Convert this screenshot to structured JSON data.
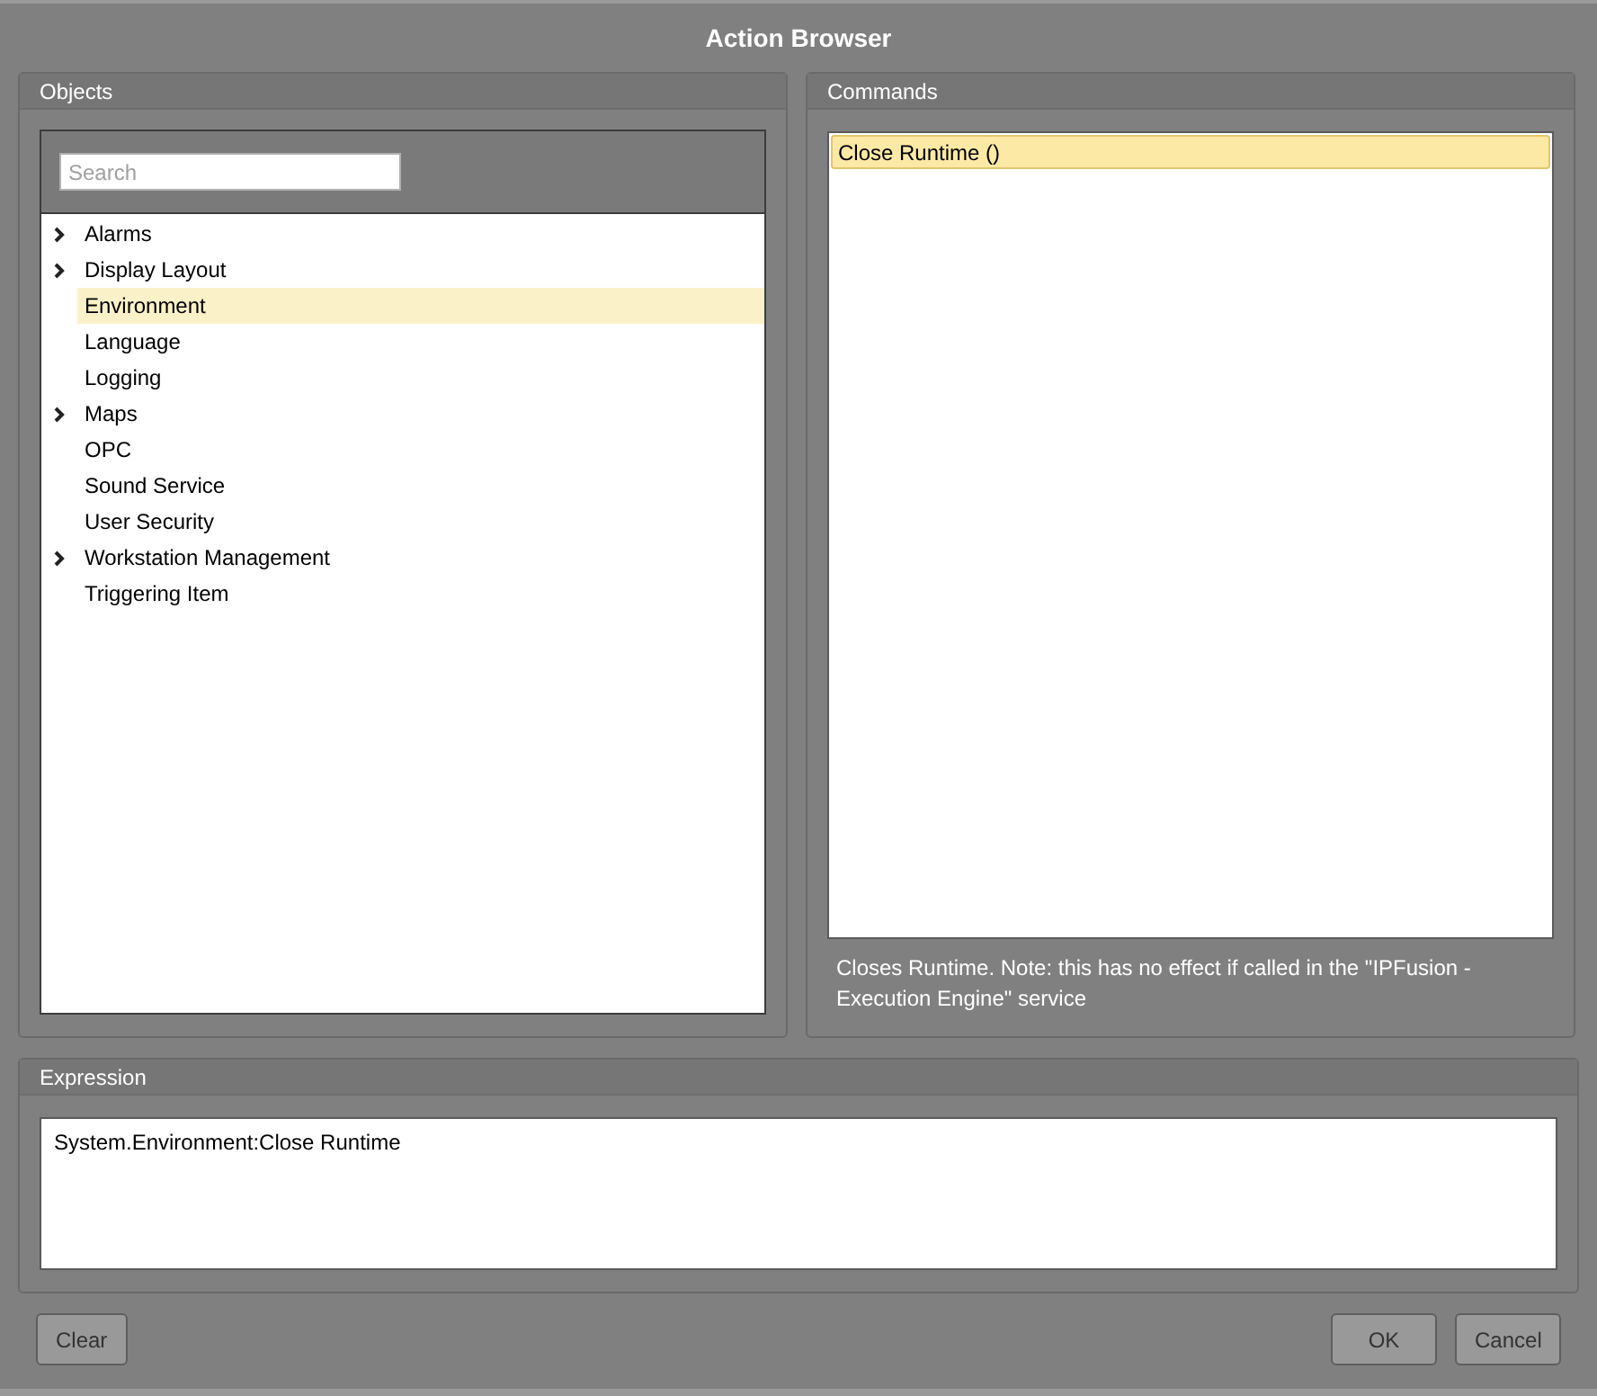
{
  "window": {
    "title": "Action Browser"
  },
  "objects": {
    "title": "Objects",
    "search": {
      "placeholder": "Search"
    },
    "items": [
      {
        "label": "Alarms",
        "expandable": true,
        "selected": false
      },
      {
        "label": "Display Layout",
        "expandable": true,
        "selected": false
      },
      {
        "label": "Environment",
        "expandable": false,
        "selected": true
      },
      {
        "label": "Language",
        "expandable": false,
        "selected": false
      },
      {
        "label": "Logging",
        "expandable": false,
        "selected": false
      },
      {
        "label": "Maps",
        "expandable": true,
        "selected": false
      },
      {
        "label": "OPC",
        "expandable": false,
        "selected": false
      },
      {
        "label": "Sound Service",
        "expandable": false,
        "selected": false
      },
      {
        "label": "User Security",
        "expandable": false,
        "selected": false
      },
      {
        "label": "Workstation Management",
        "expandable": true,
        "selected": false
      },
      {
        "label": "Triggering Item",
        "expandable": false,
        "selected": false
      }
    ]
  },
  "commands": {
    "title": "Commands",
    "items": [
      {
        "label": "Close Runtime ()",
        "selected": true
      }
    ],
    "description": "Closes Runtime. Note: this has no effect if called in the \"IPFusion - Execution Engine\" service"
  },
  "expression": {
    "title": "Expression",
    "value": "System.Environment:Close Runtime"
  },
  "buttons": {
    "left": [
      "Clear"
    ],
    "right": [
      "OK",
      "Cancel"
    ]
  }
}
